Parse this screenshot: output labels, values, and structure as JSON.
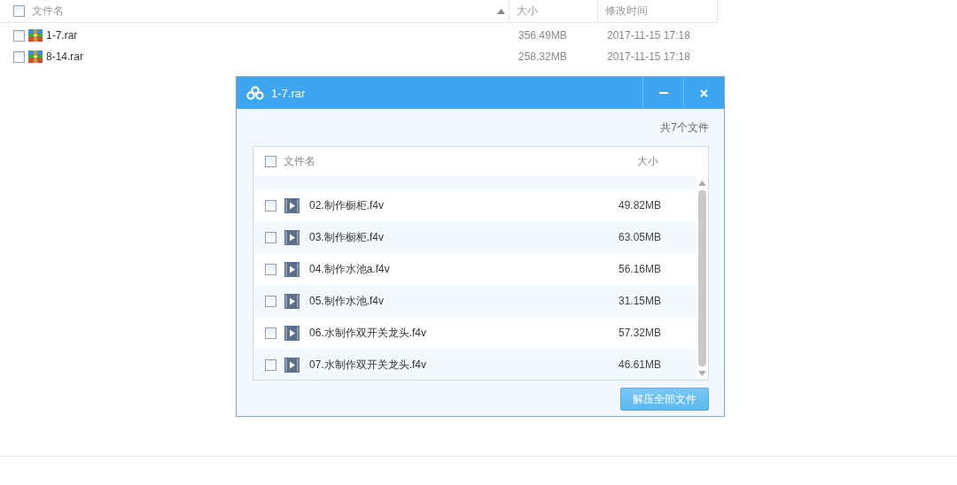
{
  "file_list": {
    "header_checked": false,
    "columns": [
      {
        "label": "文件名",
        "sorted": true
      },
      {
        "label": "大小",
        "sorted": false
      },
      {
        "label": "修改时间",
        "sorted": false
      }
    ],
    "rows": [
      {
        "name": "1-7.rar",
        "size": "356.49MB",
        "modified": "2017-11-15 17:18",
        "checked": false
      },
      {
        "name": "8-14.rar",
        "size": "258.32MB",
        "modified": "2017-11-15 17:18",
        "checked": false
      }
    ]
  },
  "dialog": {
    "title": "1-7.rar",
    "file_count": "共7个文件",
    "header_checked": false,
    "columns": [
      "文件名",
      "大小"
    ],
    "rows": [
      {
        "name": "02.制作橱柜.f4v",
        "size": "49.82MB",
        "checked": false
      },
      {
        "name": "03.制作橱柜.f4v",
        "size": "63.05MB",
        "checked": false
      },
      {
        "name": "04.制作水池a.f4v",
        "size": "56.16MB",
        "checked": false
      },
      {
        "name": "05.制作水池.f4v",
        "size": "31.15MB",
        "checked": false
      },
      {
        "name": "06.水制作双开关龙头.f4v",
        "size": "57.32MB",
        "checked": false
      },
      {
        "name": "07.水制作双开关龙头.f4v",
        "size": "46.61MB",
        "checked": false
      }
    ],
    "extract_button": "解压全部文件"
  }
}
